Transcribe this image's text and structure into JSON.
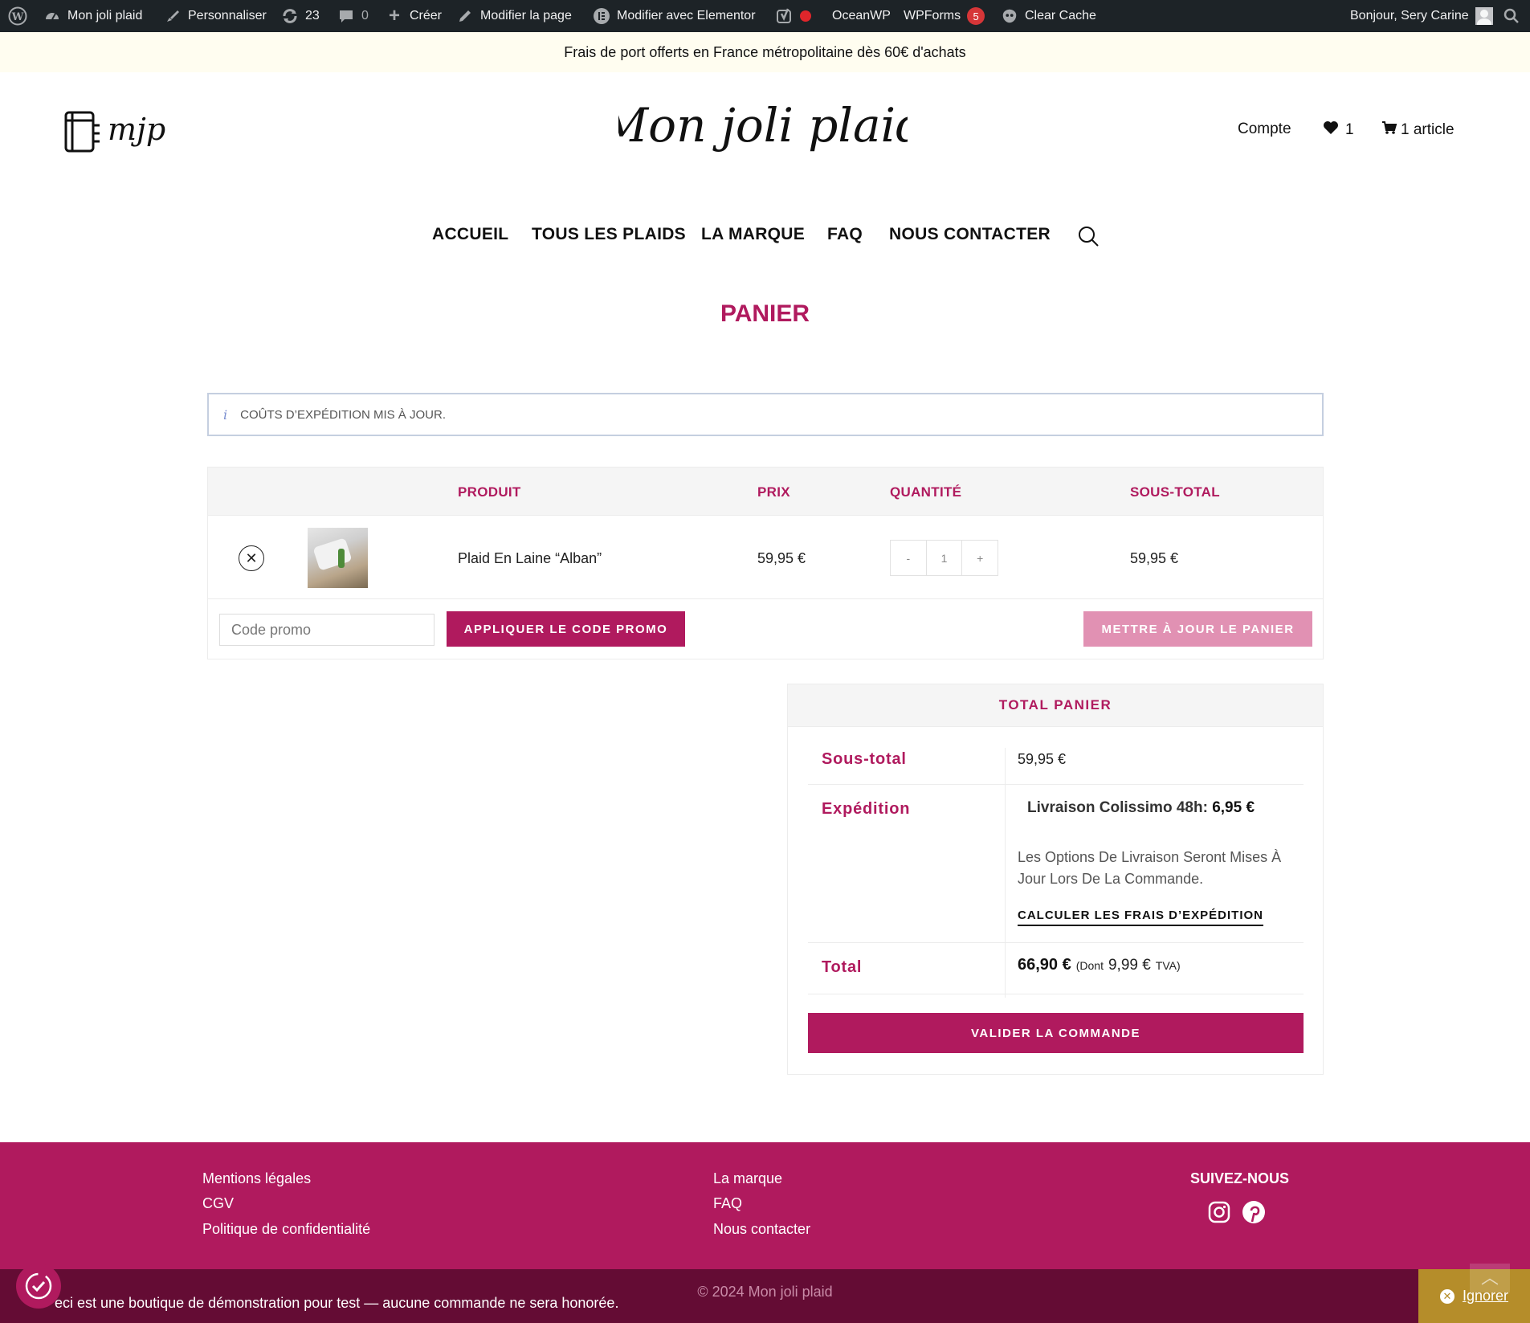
{
  "adminbar": {
    "site_name": "Mon joli plaid",
    "customize": "Personnaliser",
    "updates_count": "23",
    "comments_count": "0",
    "new": "Créer",
    "edit_page": "Modifier la page",
    "elementor": "Modifier avec Elementor",
    "oceanwp": "OceanWP",
    "wpforms": "WPForms",
    "wpforms_badge": "5",
    "clear_cache": "Clear Cache",
    "greeting": "Bonjour, Sery Carine"
  },
  "promo_bar": "Frais de port offerts en France métropolitaine dès 60€ d'achats",
  "header": {
    "logo_small_text": "mjp",
    "logo_main_text": "Mon joli plaid",
    "account": "Compte",
    "wishlist_count": "1",
    "cart_label": "1 article"
  },
  "nav": {
    "items": [
      "ACCUEIL",
      "TOUS LES PLAIDS",
      "LA MARQUE",
      "FAQ",
      "NOUS CONTACTER"
    ]
  },
  "page_title": "PANIER",
  "notice": "COÛTS D’EXPÉDITION MIS À JOUR.",
  "cart": {
    "headers": [
      "PRODUIT",
      "PRIX",
      "QUANTITÉ",
      "SOUS-TOTAL"
    ],
    "item": {
      "name": "Plaid En Laine “Alban”",
      "price": "59,95 €",
      "qty_minus": "-",
      "qty": "1",
      "qty_plus": "+",
      "subtotal": "59,95 €"
    },
    "coupon_placeholder": "Code promo",
    "apply_button": "APPLIQUER LE CODE PROMO",
    "update_button": "METTRE À JOUR LE PANIER"
  },
  "totals": {
    "title": "TOTAL PANIER",
    "subtotal_label": "Sous-total",
    "subtotal_value": "59,95 €",
    "shipping_label": "Expédition",
    "shipping_method": "Livraison Colissimo 48h:",
    "shipping_price": "6,95 €",
    "shipping_note_1": "Les Options De Livraison Seront Mises À",
    "shipping_note_2": "Jour Lors De La Commande.",
    "calc_shipping": "CALCULER LES FRAIS D’EXPÉDITION",
    "total_label": "Total",
    "total_value": "66,90 €",
    "tax_prefix": "(Dont",
    "tax_value": "9,99 €",
    "tax_suffix": "TVA)",
    "checkout_button": "VALIDER LA COMMANDE"
  },
  "footer": {
    "col1": [
      "Mentions légales",
      "CGV",
      "Politique de confidentialité"
    ],
    "col2": [
      "La marque",
      "FAQ",
      "Nous contacter"
    ],
    "follow_title": "SUIVEZ-NOUS",
    "copyright": "© 2024 Mon joli plaid",
    "demo_notice": "eci est une boutique de démonstration pour test — aucune commande ne sera honorée.",
    "ignore": "Ignorer"
  },
  "colors": {
    "brand": "#b01a5e",
    "brand_light": "#e191b3",
    "admin_bar": "#1d2327",
    "bottom_bar": "#640c34",
    "ignore_bg": "#b58d2a"
  }
}
